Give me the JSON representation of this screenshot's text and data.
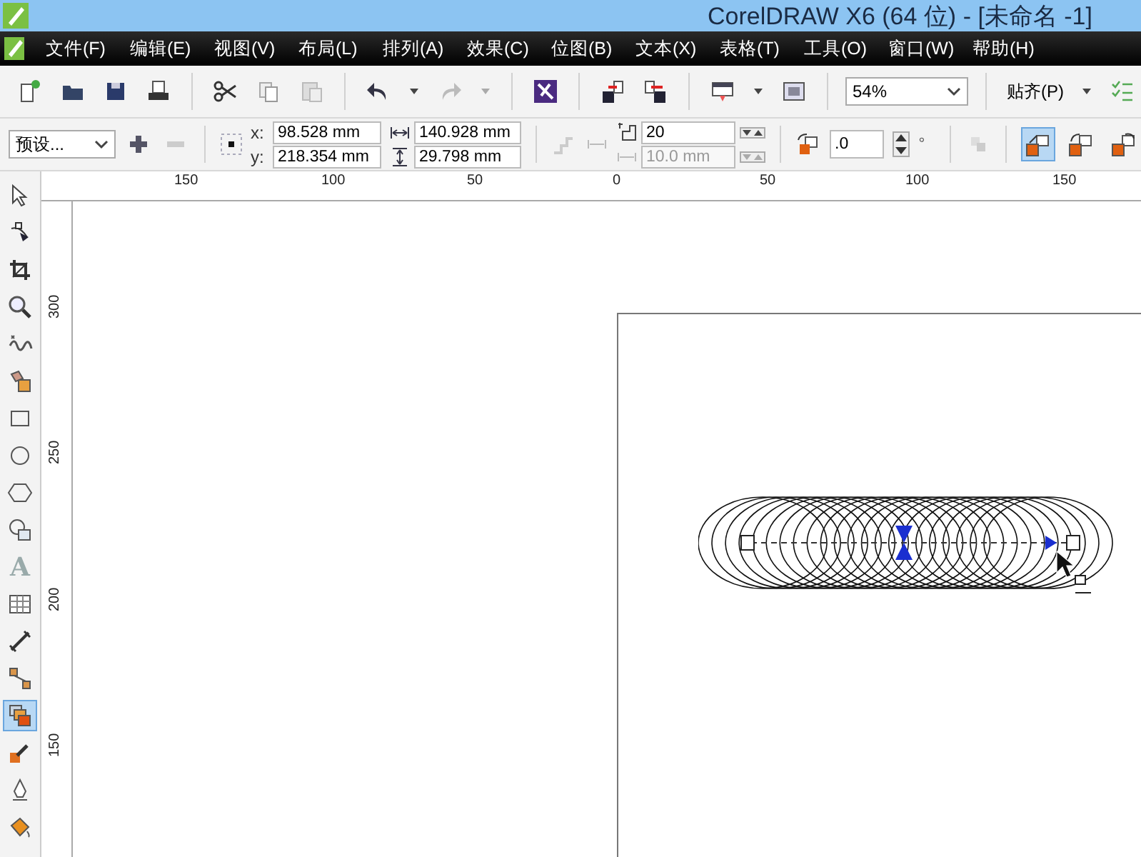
{
  "window": {
    "title": "CorelDRAW X6 (64 位) - [未命名 -1]"
  },
  "menu": [
    {
      "label": "文件(F)"
    },
    {
      "label": "编辑(E)"
    },
    {
      "label": "视图(V)"
    },
    {
      "label": "布局(L)"
    },
    {
      "label": "排列(A)"
    },
    {
      "label": "效果(C)"
    },
    {
      "label": "位图(B)"
    },
    {
      "label": "文本(X)"
    },
    {
      "label": "表格(T)"
    },
    {
      "label": "工具(O)"
    },
    {
      "label": "窗口(W)"
    },
    {
      "label": "帮助(H)"
    }
  ],
  "standard_toolbar": {
    "zoom": "54%",
    "snap": "贴齐(P)"
  },
  "property_bar": {
    "preset": "预设...",
    "x_label": "x:",
    "x": "98.528 mm",
    "y_label": "y:",
    "y": "218.354 mm",
    "width": "140.928 mm",
    "height": "29.798 mm",
    "steps": "20",
    "spacing": "10.0 mm",
    "spacing_disabled": true,
    "rotation": ".0",
    "rotation_unit": "°",
    "blend_modes": [
      {
        "kind": "direct",
        "selected": true
      },
      {
        "kind": "clockwise",
        "selected": false
      },
      {
        "kind": "counterclockwise",
        "selected": false
      }
    ]
  },
  "horizontal_ruler": [
    "150",
    "100",
    "50",
    "0",
    "50",
    "100",
    "150"
  ],
  "vertical_ruler": [
    "300",
    "250",
    "200",
    "150"
  ],
  "tools": [
    {
      "kind": "pick",
      "selected": false
    },
    {
      "kind": "shape",
      "selected": false
    },
    {
      "kind": "crop",
      "selected": false
    },
    {
      "kind": "zoom",
      "selected": false
    },
    {
      "kind": "freehand",
      "selected": false
    },
    {
      "kind": "smartfill",
      "selected": false
    },
    {
      "kind": "rectangle",
      "selected": false
    },
    {
      "kind": "ellipse",
      "selected": false
    },
    {
      "kind": "polygon",
      "selected": false
    },
    {
      "kind": "basicshapes",
      "selected": false
    },
    {
      "kind": "text",
      "glyph": "A",
      "selected": false
    },
    {
      "kind": "table",
      "selected": false
    },
    {
      "kind": "dimension",
      "selected": false
    },
    {
      "kind": "connector",
      "selected": false
    },
    {
      "kind": "blend",
      "selected": true
    },
    {
      "kind": "eyedropper",
      "selected": false
    },
    {
      "kind": "outline",
      "selected": false
    },
    {
      "kind": "fill",
      "selected": false
    }
  ]
}
